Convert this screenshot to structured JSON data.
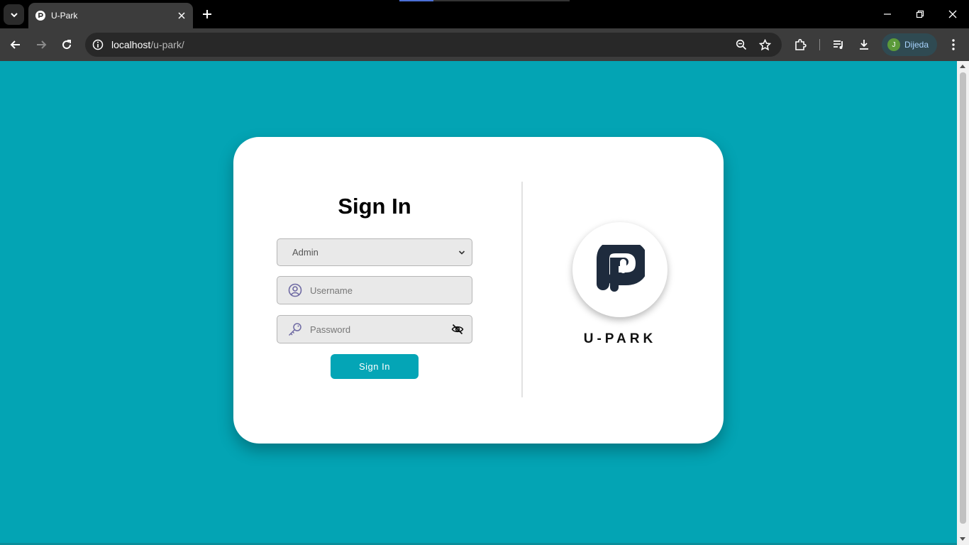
{
  "browser": {
    "tab_title": "U-Park",
    "url_host": "localhost",
    "url_path": "/u-park/",
    "profile_initial": "J",
    "profile_name": "Dijeda"
  },
  "icons": {
    "tab_search": "chevron-down-icon",
    "favicon": "u-park-favicon",
    "close": "close-icon",
    "new_tab": "plus-icon",
    "back": "arrow-left-icon",
    "forward": "arrow-right-icon",
    "reload": "reload-icon",
    "info": "info-icon",
    "zoom": "zoom-out-icon",
    "bookmark": "star-icon",
    "extensions": "puzzle-icon",
    "media": "media-queue-icon",
    "downloads": "download-icon",
    "menu": "three-dots-icon",
    "user": "user-circle-icon",
    "key": "key-icon",
    "eye_slash": "eye-slash-icon"
  },
  "login": {
    "heading": "Sign In",
    "role_selected": "Admin",
    "username_placeholder": "Username",
    "password_placeholder": "Password",
    "submit_label": "Sign In"
  },
  "brand": {
    "name": "U-PARK"
  },
  "colors": {
    "page_background": "#03a4b4",
    "accent": "#04a5b6",
    "logo_dark": "#1e2b3d"
  }
}
